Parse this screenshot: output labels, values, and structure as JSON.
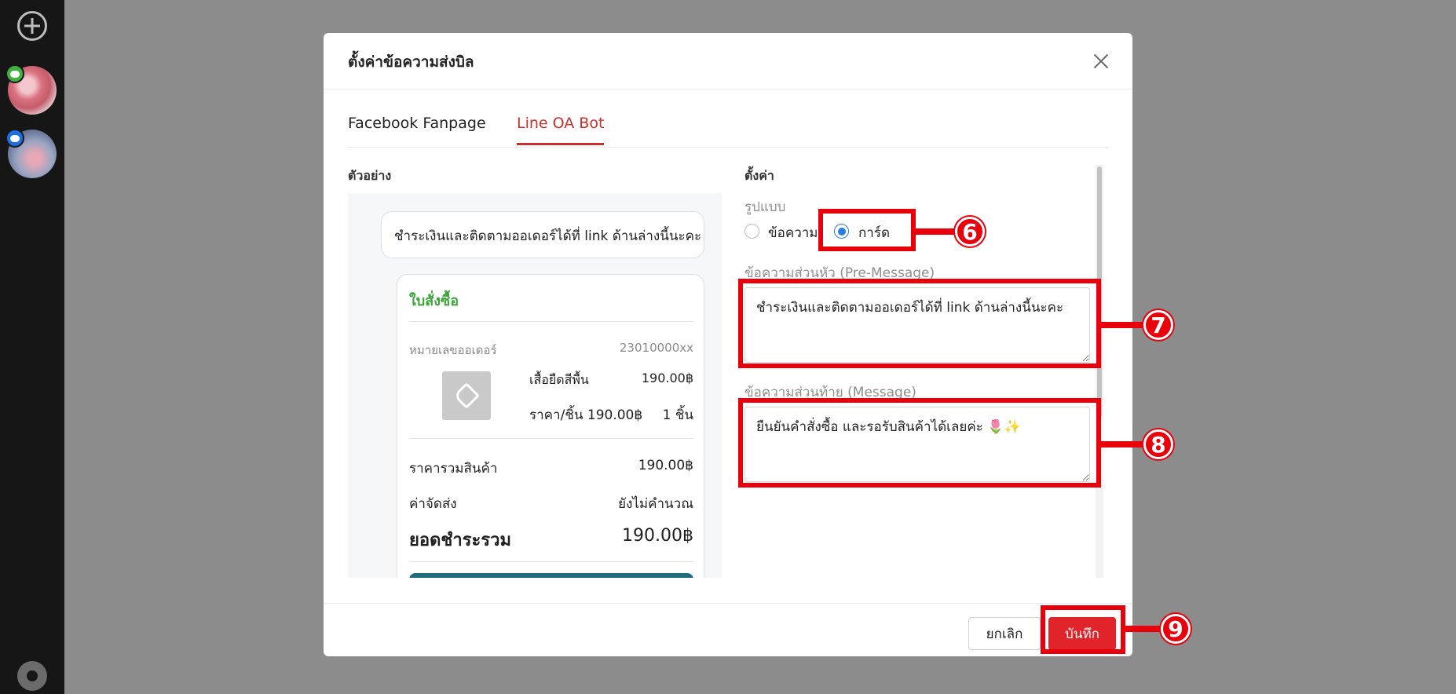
{
  "modal": {
    "title": "ตั้งค่าข้อความส่งบิล",
    "tabs": [
      "Facebook Fanpage",
      "Line OA Bot"
    ],
    "active_tab": "Line OA Bot"
  },
  "preview": {
    "section_title": "ตัวอย่าง",
    "pre_message": "ชำระเงินและติดตามออเดอร์ได้ที่ link ด้านล่างนี้นะคะ",
    "card": {
      "title": "ใบสั่งซื้อ",
      "order_label": "หมายเลขออเดอร์",
      "order_number": "23010000xx",
      "product_name": "เสื้อยืดสีพื้น",
      "product_price": "190.00฿",
      "unit_price": "ราคา/ชิ้น 190.00฿",
      "quantity": "1 ชิ้น",
      "subtotal_label": "ราคารวมสินค้า",
      "subtotal_value": "190.00฿",
      "shipping_label": "ค่าจัดส่ง",
      "shipping_value": "ยังไม่คำนวณ",
      "total_label": "ยอดชำระรวม",
      "total_value": "190.00฿"
    }
  },
  "settings": {
    "section_title": "ตั้งค่า",
    "format_label": "รูปแบบ",
    "format_options": [
      "ข้อความ",
      "การ์ด"
    ],
    "format_selected": "การ์ด",
    "pre_message_label": "ข้อความส่วนหัว (Pre-Message)",
    "pre_message_value": "ชำระเงินและติดตามออเดอร์ได้ที่ link ด้านล่างนี้นะคะ",
    "message_label": "ข้อความส่วนท้าย (Message)",
    "message_value": "ยืนยันคำสั่งซื้อ และรอรับสินค้าได้เลยค่ะ 🌷✨"
  },
  "footer": {
    "cancel_label": "ยกเลิก",
    "save_label": "บันทึก"
  },
  "annotations": [
    "6",
    "7",
    "8",
    "9"
  ],
  "colors": {
    "accent_red": "#c9302c",
    "save_button": "#e0242a",
    "annotation_red": "#e8000b",
    "card_title_green": "#3aa536",
    "radio_blue": "#2a7de1"
  }
}
